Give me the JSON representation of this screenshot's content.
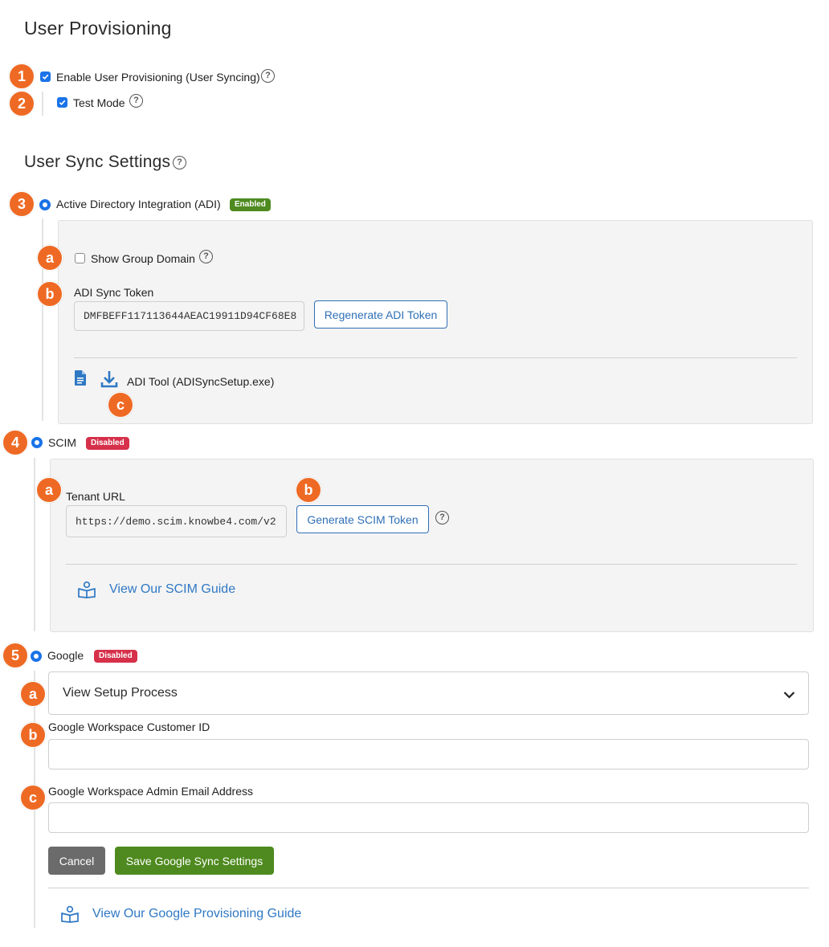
{
  "page": {
    "title": "User Provisioning",
    "help_glyph": "?"
  },
  "provisioning": {
    "enable_label": "Enable User Provisioning (User Syncing)",
    "enable_checked": true,
    "test_mode_label": "Test Mode",
    "test_mode_checked": true
  },
  "sync_settings": {
    "title": "User Sync Settings"
  },
  "markers": [
    "1",
    "2",
    "3",
    "4",
    "5",
    "a",
    "b",
    "c"
  ],
  "adi": {
    "label": "Active Directory Integration (ADI)",
    "badge": "Enabled",
    "badge_color": "#4e8a1f",
    "show_group_domain_label": "Show Group Domain",
    "show_group_domain_checked": false,
    "token_label": "ADI Sync Token",
    "token_value": "DMFBEFF117113644AEAC19911D94CF68E8",
    "regenerate_button": "Regenerate ADI Token",
    "tool_label": "ADI Tool (ADISyncSetup.exe)",
    "icons": [
      "document-icon",
      "download-icon"
    ]
  },
  "scim": {
    "label": "SCIM",
    "badge": "Disabled",
    "badge_color": "#d6304a",
    "tenant_url_label": "Tenant URL",
    "tenant_url_value": "https://demo.scim.knowbe4.com/v2",
    "generate_button": "Generate SCIM Token",
    "guide_link": "View Our SCIM Guide",
    "guide_icon": "book-icon"
  },
  "google": {
    "label": "Google",
    "badge": "Disabled",
    "badge_color": "#d6304a",
    "setup_dropdown": "View Setup Process",
    "customer_id_label": "Google Workspace Customer ID",
    "customer_id_value": "",
    "admin_email_label": "Google Workspace Admin Email Address",
    "admin_email_value": "",
    "cancel_button": "Cancel",
    "save_button": "Save Google Sync Settings",
    "guide_link": "View Our Google Provisioning Guide",
    "guide_icon": "book-icon"
  },
  "colors": {
    "accent": "#1a73e8",
    "marker": "#ee6a24",
    "link": "#2f78c4",
    "save_button": "#4e8a1f",
    "cancel_button": "#6b6b6b"
  }
}
